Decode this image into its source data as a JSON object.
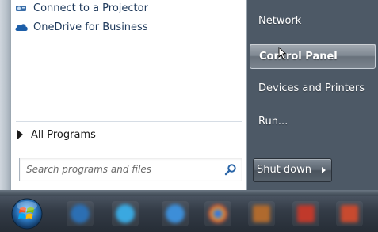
{
  "left_panel": {
    "items": [
      {
        "label": "Connect to a Projector",
        "icon": "projector-icon"
      },
      {
        "label": "OneDrive for Business",
        "icon": "onedrive-cloud-icon"
      }
    ],
    "all_programs": "All Programs",
    "search": {
      "placeholder": "Search programs and files",
      "icon": "search-icon"
    }
  },
  "right_panel": {
    "items": [
      "Network",
      "Control Panel",
      "Devices and Printers",
      "Run..."
    ],
    "highlighted": "Control Panel"
  },
  "shutdown": {
    "label": "Shut down",
    "arrow_icon": "chevron-right-icon"
  },
  "taskbar": {
    "start_icon": "windows-start-orb-icon",
    "apps": [
      {
        "icon": "outlook-icon",
        "color": "#2c6fb3"
      },
      {
        "icon": "skype-icon",
        "color": "#3aa8e0"
      },
      {
        "icon": "internet-explorer-icon",
        "color": "#3d8ed8"
      },
      {
        "icon": "chrome-icon",
        "color": "#d9a53a"
      },
      {
        "icon": "acrobat-icon",
        "color": "#b06a2e"
      },
      {
        "icon": "pdf-icon",
        "color": "#c0392b"
      },
      {
        "icon": "powerpoint-icon",
        "color": "#c84a2f"
      }
    ]
  },
  "colors": {
    "menu_right_bg": "#4d5966",
    "hover_highlight": "#7e8791",
    "text_link": "#1e395b"
  }
}
